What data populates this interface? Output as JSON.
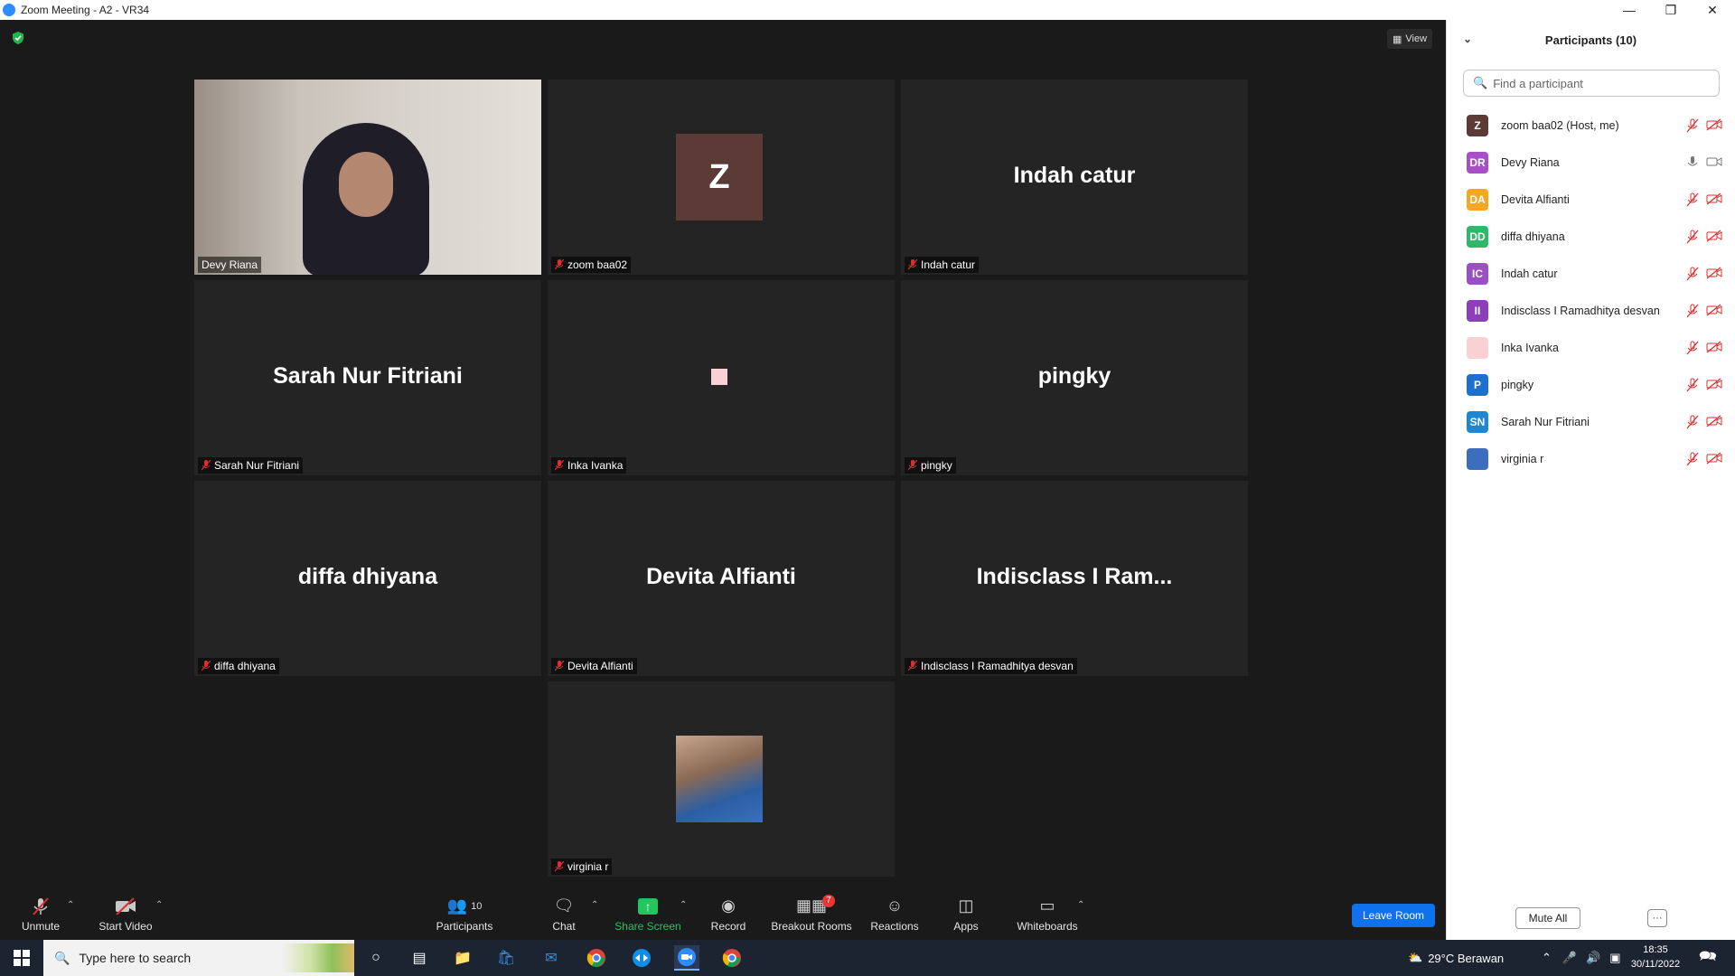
{
  "window": {
    "title": "Zoom Meeting - A2 - VR34"
  },
  "stage": {
    "view_label": "View",
    "tiles": [
      {
        "label": "Devy Riana",
        "big": "",
        "kind": "video"
      },
      {
        "label": "zoom baa02",
        "big": "Z",
        "kind": "avatar"
      },
      {
        "label": "Indah catur",
        "big": "Indah catur",
        "kind": "name"
      },
      {
        "label": "Sarah Nur Fitriani",
        "big": "Sarah Nur Fitriani",
        "kind": "name"
      },
      {
        "label": "Inka Ivanka",
        "big": "",
        "kind": "pink"
      },
      {
        "label": "pingky",
        "big": "pingky",
        "kind": "name"
      },
      {
        "label": "diffa dhiyana",
        "big": "diffa dhiyana",
        "kind": "name"
      },
      {
        "label": "Devita Alfianti",
        "big": "Devita Alfianti",
        "kind": "name"
      },
      {
        "label": "Indisclass I Ramadhitya desvan",
        "big": "Indisclass I Ram...",
        "kind": "name"
      },
      {
        "label": "virginia r",
        "big": "",
        "kind": "photo"
      }
    ]
  },
  "toolbar": {
    "unmute": "Unmute",
    "start_video": "Start Video",
    "participants": "Participants",
    "participants_count": "10",
    "chat": "Chat",
    "share_screen": "Share Screen",
    "record": "Record",
    "breakout_rooms": "Breakout Rooms",
    "breakout_badge": "7",
    "reactions": "Reactions",
    "apps": "Apps",
    "whiteboards": "Whiteboards",
    "leave_room": "Leave Room"
  },
  "panel": {
    "title": "Participants (10)",
    "search_placeholder": "Find a participant",
    "participants": [
      {
        "initials": "Z",
        "name": "zoom baa02 (Host, me)",
        "color": "#5c3a35",
        "mic": "off",
        "cam": "off"
      },
      {
        "initials": "DR",
        "name": "Devy Riana",
        "color": "#a84ec9",
        "mic": "on",
        "cam": "on"
      },
      {
        "initials": "DA",
        "name": "Devita Alfianti",
        "color": "#f5a623",
        "mic": "off",
        "cam": "off"
      },
      {
        "initials": "DD",
        "name": "diffa dhiyana",
        "color": "#2fb86a",
        "mic": "off",
        "cam": "off"
      },
      {
        "initials": "IC",
        "name": "Indah catur",
        "color": "#9b4fc6",
        "mic": "off",
        "cam": "off"
      },
      {
        "initials": "II",
        "name": "Indisclass I Ramadhitya desvan",
        "color": "#8c3fb8",
        "mic": "off",
        "cam": "off"
      },
      {
        "initials": "",
        "name": "Inka Ivanka",
        "color": "#f9d0d4",
        "mic": "off",
        "cam": "off"
      },
      {
        "initials": "P",
        "name": "pingky",
        "color": "#1f6fd1",
        "mic": "off",
        "cam": "off"
      },
      {
        "initials": "SN",
        "name": "Sarah Nur Fitriani",
        "color": "#1f86d1",
        "mic": "off",
        "cam": "off"
      },
      {
        "initials": "",
        "name": "virginia r",
        "color": "#3b6fbd",
        "mic": "off",
        "cam": "off"
      }
    ],
    "mute_all": "Mute All",
    "more": "···"
  },
  "taskbar": {
    "search_placeholder": "Type here to search",
    "weather": "29°C  Berawan",
    "time": "18:35",
    "date": "30/11/2022"
  }
}
